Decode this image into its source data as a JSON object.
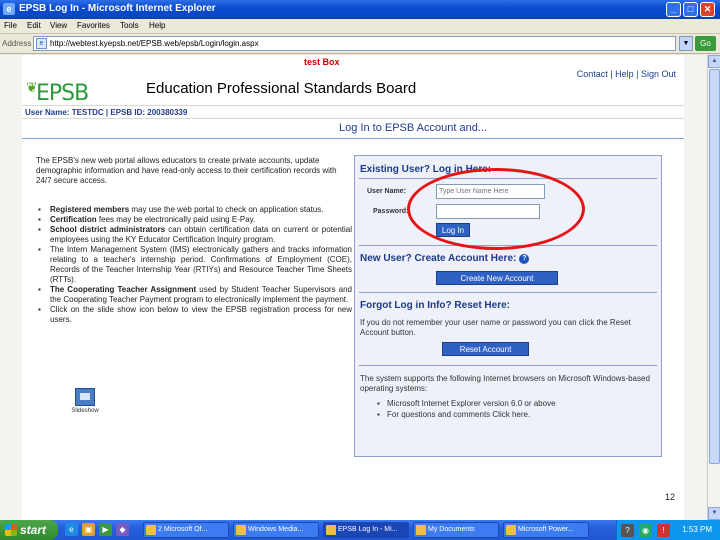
{
  "window": {
    "title": "EPSB Log In - Microsoft Internet Explorer",
    "min": "_",
    "max": "□",
    "close": "✕"
  },
  "menu": [
    "File",
    "Edit",
    "View",
    "Favorites",
    "Tools",
    "Help"
  ],
  "address": {
    "label": "Address",
    "url": "http://webtest.kyepsb.net/EPSB.web/epsb/Login/login.aspx",
    "go": "Go"
  },
  "page": {
    "test_box": "test Box",
    "top_links": "Contact | Help | Sign Out",
    "logo": "EPSB",
    "board_name": "Education Professional Standards Board",
    "user_info": "User Name: TESTDC  |  EPSB ID: 200380339",
    "heading": "Log In to EPSB Account and...",
    "intro": "The EPSB's new web portal allows educators to create private accounts, update demographic information and have read-only access to their certification records with 24/7 secure access.",
    "bullets": [
      {
        "bold": "Registered members",
        "text": " may use the web portal to check on application status."
      },
      {
        "bold": "Certification",
        "text": " fees may be electronically paid using E-Pay."
      },
      {
        "bold": "School district administrators",
        "text": " can obtain certification data on current or potential employees using the KY Educator Certification Inquiry program."
      },
      {
        "bold": "",
        "text": "The Intern Management System (IMS) electronically gathers and tracks information relating to a teacher's internship period. Confirmations of Employment (COE), Records of the Teacher Internship Year (RTIYs) and Resource Teacher Time Sheets (RTTs)."
      },
      {
        "bold": "The Cooperating Teacher Assignment",
        "text": " used by Student Teacher Supervisors and the Cooperating Teacher Payment program to electronically implement the payment."
      },
      {
        "bold": "",
        "text": "Click on the slide show icon below to view the EPSB registration process for new users."
      }
    ],
    "slideshow_label": "Slideshow",
    "page_number": "12"
  },
  "login_panel": {
    "existing_title": "Existing User? Log in Here:",
    "username_label": "User Name:",
    "username_placeholder": "Type User Name Here",
    "password_label": "Password:",
    "login_button": "Log In",
    "new_user_title": "New User? Create Account Here:",
    "help_icon": "?",
    "create_button": "Create New Account",
    "forgot_title": "Forgot Log in Info? Reset Here:",
    "forgot_text": "If you do not remember your user name or password you can click the Reset Account button.",
    "reset_button": "Reset Account",
    "browser_intro": "The system supports the following Internet browsers on Microsoft Windows-based operating systems:",
    "browsers": [
      "Microsoft Internet Explorer version 6.0 or above",
      "For questions and comments Click here."
    ]
  },
  "taskbar": {
    "start": "start",
    "tasks": [
      "2 Microsoft Of...",
      "Windows Media...",
      "EPSB Log In - Mi...",
      "My Documents",
      "Microsoft Power..."
    ],
    "clock": "1:53 PM"
  },
  "colors": {
    "accent_blue": "#1e3c8c",
    "logo_green": "#2c9a3a",
    "annotation_red": "#e61414",
    "button_blue": "#2f61c5"
  }
}
